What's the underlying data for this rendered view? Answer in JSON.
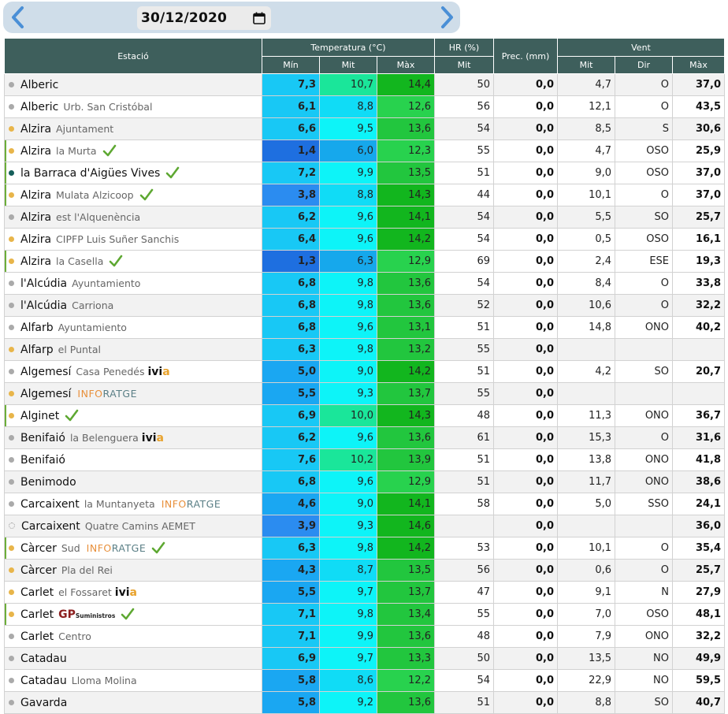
{
  "header": {
    "date": "30/12/2020"
  },
  "columns": {
    "station": "Estació",
    "temp": "Temperatura (°C)",
    "hr": "HR (%)",
    "prec": "Prec. (mm)",
    "wind": "Vent",
    "tmin": "Mín",
    "tmit": "Mit",
    "tmax": "Màx",
    "hrmit": "Mit",
    "wmit": "Mit",
    "wdir": "Dir",
    "wmax": "Màx"
  },
  "colors": {
    "header_bg": "#3e5f5c",
    "dot_orange": "#e8b54a",
    "dot_gray": "#aaaaaa",
    "dot_teal": "#155e5a",
    "check_green": "#5ea832"
  },
  "rows": [
    {
      "name": "Alberic",
      "sub": "",
      "dot": "gray",
      "check": false,
      "hl": false,
      "logo": "",
      "tmin": "7,3",
      "tmit": "10,7",
      "tmax": "14,4",
      "hr": "50",
      "prec": "0,0",
      "wmit": "4,7",
      "wdir": "O",
      "wmax": "37,0"
    },
    {
      "name": "Alberic",
      "sub": "Urb. San Cristóbal",
      "dot": "gray",
      "check": false,
      "hl": false,
      "logo": "",
      "tmin": "6,1",
      "tmit": "8,8",
      "tmax": "12,6",
      "hr": "56",
      "prec": "0,0",
      "wmit": "12,1",
      "wdir": "O",
      "wmax": "43,5"
    },
    {
      "name": "Alzira",
      "sub": "Ajuntament",
      "dot": "orange",
      "check": false,
      "hl": false,
      "logo": "",
      "tmin": "6,6",
      "tmit": "9,5",
      "tmax": "13,6",
      "hr": "54",
      "prec": "0,0",
      "wmit": "8,5",
      "wdir": "S",
      "wmax": "30,6"
    },
    {
      "name": "Alzira",
      "sub": "la Murta",
      "dot": "orange",
      "check": true,
      "hl": true,
      "logo": "",
      "tmin": "1,4",
      "tmit": "6,0",
      "tmax": "12,3",
      "hr": "55",
      "prec": "0,0",
      "wmit": "4,7",
      "wdir": "OSO",
      "wmax": "25,9"
    },
    {
      "name": "la Barraca d'Aigües Vives",
      "sub": "",
      "dot": "teal",
      "check": true,
      "hl": true,
      "logo": "",
      "tmin": "7,2",
      "tmit": "9,9",
      "tmax": "13,5",
      "hr": "51",
      "prec": "0,0",
      "wmit": "9,0",
      "wdir": "OSO",
      "wmax": "37,0"
    },
    {
      "name": "Alzira",
      "sub": "Mulata Alzicoop",
      "dot": "orange",
      "check": true,
      "hl": true,
      "logo": "",
      "tmin": "3,8",
      "tmit": "8,8",
      "tmax": "14,3",
      "hr": "44",
      "prec": "0,0",
      "wmit": "10,1",
      "wdir": "O",
      "wmax": "37,0"
    },
    {
      "name": "Alzira",
      "sub": "est l'Alquenència",
      "dot": "gray",
      "check": false,
      "hl": false,
      "logo": "",
      "tmin": "6,2",
      "tmit": "9,6",
      "tmax": "14,1",
      "hr": "54",
      "prec": "0,0",
      "wmit": "5,5",
      "wdir": "SO",
      "wmax": "25,7"
    },
    {
      "name": "Alzira",
      "sub": "CIPFP Luis Suñer Sanchis",
      "dot": "orange",
      "check": false,
      "hl": false,
      "logo": "",
      "tmin": "6,4",
      "tmit": "9,6",
      "tmax": "14,2",
      "hr": "54",
      "prec": "0,0",
      "wmit": "0,5",
      "wdir": "OSO",
      "wmax": "16,1"
    },
    {
      "name": "Alzira",
      "sub": "la Casella",
      "dot": "orange",
      "check": true,
      "hl": true,
      "logo": "",
      "tmin": "1,3",
      "tmit": "6,3",
      "tmax": "12,9",
      "hr": "69",
      "prec": "0,0",
      "wmit": "2,4",
      "wdir": "ESE",
      "wmax": "19,3"
    },
    {
      "name": "l'Alcúdia",
      "sub": "Ayuntamiento",
      "dot": "gray",
      "check": false,
      "hl": false,
      "logo": "",
      "tmin": "6,8",
      "tmit": "9,8",
      "tmax": "13,6",
      "hr": "54",
      "prec": "0,0",
      "wmit": "8,4",
      "wdir": "O",
      "wmax": "33,8"
    },
    {
      "name": "l'Alcúdia",
      "sub": "Carriona",
      "dot": "gray",
      "check": false,
      "hl": false,
      "logo": "",
      "tmin": "6,8",
      "tmit": "9,8",
      "tmax": "13,6",
      "hr": "52",
      "prec": "0,0",
      "wmit": "10,6",
      "wdir": "O",
      "wmax": "32,2"
    },
    {
      "name": "Alfarb",
      "sub": "Ayuntamiento",
      "dot": "gray",
      "check": false,
      "hl": false,
      "logo": "",
      "tmin": "6,8",
      "tmit": "9,6",
      "tmax": "13,1",
      "hr": "51",
      "prec": "0,0",
      "wmit": "14,8",
      "wdir": "ONO",
      "wmax": "40,2"
    },
    {
      "name": "Alfarp",
      "sub": "el Puntal",
      "dot": "orange",
      "check": false,
      "hl": false,
      "logo": "",
      "tmin": "6,3",
      "tmit": "9,8",
      "tmax": "13,2",
      "hr": "55",
      "prec": "0,0",
      "wmit": "",
      "wdir": "",
      "wmax": ""
    },
    {
      "name": "Algemesí",
      "sub": "Casa Penedés",
      "dot": "gray",
      "check": false,
      "hl": false,
      "logo": "ivia",
      "tmin": "5,0",
      "tmit": "9,0",
      "tmax": "14,2",
      "hr": "51",
      "prec": "0,0",
      "wmit": "4,2",
      "wdir": "SO",
      "wmax": "20,7"
    },
    {
      "name": "Algemesí",
      "sub": "",
      "dot": "orange",
      "check": false,
      "hl": false,
      "logo": "inforatge",
      "tmin": "5,5",
      "tmit": "9,3",
      "tmax": "13,7",
      "hr": "55",
      "prec": "0,0",
      "wmit": "",
      "wdir": "",
      "wmax": ""
    },
    {
      "name": "Alginet",
      "sub": "",
      "dot": "orange",
      "check": true,
      "hl": true,
      "logo": "",
      "tmin": "6,9",
      "tmit": "10,0",
      "tmax": "14,3",
      "hr": "48",
      "prec": "0,0",
      "wmit": "11,3",
      "wdir": "ONO",
      "wmax": "36,7"
    },
    {
      "name": "Benifaió",
      "sub": "la Belenguera",
      "dot": "gray",
      "check": false,
      "hl": false,
      "logo": "ivia",
      "tmin": "6,2",
      "tmit": "9,6",
      "tmax": "13,6",
      "hr": "61",
      "prec": "0,0",
      "wmit": "15,3",
      "wdir": "O",
      "wmax": "31,6"
    },
    {
      "name": "Benifaió",
      "sub": "",
      "dot": "gray",
      "check": false,
      "hl": false,
      "logo": "",
      "tmin": "7,6",
      "tmit": "10,2",
      "tmax": "13,9",
      "hr": "51",
      "prec": "0,0",
      "wmit": "13,8",
      "wdir": "ONO",
      "wmax": "41,8"
    },
    {
      "name": "Benimodo",
      "sub": "",
      "dot": "gray",
      "check": false,
      "hl": false,
      "logo": "",
      "tmin": "6,8",
      "tmit": "9,6",
      "tmax": "12,9",
      "hr": "51",
      "prec": "0,0",
      "wmit": "11,7",
      "wdir": "ONO",
      "wmax": "38,6"
    },
    {
      "name": "Carcaixent",
      "sub": "la Muntanyeta",
      "dot": "gray",
      "check": false,
      "hl": false,
      "logo": "inforatge",
      "tmin": "4,6",
      "tmit": "9,0",
      "tmax": "14,1",
      "hr": "58",
      "prec": "0,0",
      "wmit": "5,0",
      "wdir": "SSO",
      "wmax": "24,1"
    },
    {
      "name": "Carcaixent",
      "sub": "Quatre Camins AEMET",
      "dot": "dotted",
      "check": false,
      "hl": false,
      "logo": "",
      "tmin": "3,9",
      "tmit": "9,3",
      "tmax": "14,6",
      "hr": "",
      "prec": "0,0",
      "wmit": "",
      "wdir": "",
      "wmax": "36,0"
    },
    {
      "name": "Càrcer",
      "sub": "Sud",
      "dot": "orange",
      "check": true,
      "hl": true,
      "logo": "inforatge",
      "tmin": "6,3",
      "tmit": "9,8",
      "tmax": "14,2",
      "hr": "53",
      "prec": "0,0",
      "wmit": "10,1",
      "wdir": "O",
      "wmax": "35,4"
    },
    {
      "name": "Càrcer",
      "sub": "Pla del Rei",
      "dot": "orange",
      "check": false,
      "hl": false,
      "logo": "",
      "tmin": "4,3",
      "tmit": "8,7",
      "tmax": "13,5",
      "hr": "56",
      "prec": "0,0",
      "wmit": "0,6",
      "wdir": "O",
      "wmax": "25,7"
    },
    {
      "name": "Carlet",
      "sub": "el Fossaret",
      "dot": "orange",
      "check": false,
      "hl": false,
      "logo": "ivia",
      "tmin": "5,5",
      "tmit": "9,7",
      "tmax": "13,7",
      "hr": "47",
      "prec": "0,0",
      "wmit": "9,1",
      "wdir": "N",
      "wmax": "27,9"
    },
    {
      "name": "Carlet",
      "sub": "",
      "dot": "orange",
      "check": true,
      "hl": true,
      "logo": "gp",
      "tmin": "7,1",
      "tmit": "9,8",
      "tmax": "13,4",
      "hr": "55",
      "prec": "0,0",
      "wmit": "7,0",
      "wdir": "OSO",
      "wmax": "48,1"
    },
    {
      "name": "Carlet",
      "sub": "Centro",
      "dot": "gray",
      "check": false,
      "hl": false,
      "logo": "",
      "tmin": "7,1",
      "tmit": "9,9",
      "tmax": "13,6",
      "hr": "48",
      "prec": "0,0",
      "wmit": "7,9",
      "wdir": "ONO",
      "wmax": "32,2"
    },
    {
      "name": "Catadau",
      "sub": "",
      "dot": "gray",
      "check": false,
      "hl": false,
      "logo": "",
      "tmin": "6,9",
      "tmit": "9,7",
      "tmax": "13,3",
      "hr": "50",
      "prec": "0,0",
      "wmit": "13,5",
      "wdir": "NO",
      "wmax": "49,9"
    },
    {
      "name": "Catadau",
      "sub": "Lloma Molina",
      "dot": "gray",
      "check": false,
      "hl": false,
      "logo": "",
      "tmin": "5,8",
      "tmit": "8,6",
      "tmax": "12,2",
      "hr": "54",
      "prec": "0,0",
      "wmit": "22,9",
      "wdir": "NO",
      "wmax": "59,5"
    },
    {
      "name": "Gavarda",
      "sub": "",
      "dot": "gray",
      "check": false,
      "hl": false,
      "logo": "",
      "tmin": "5,8",
      "tmit": "9,2",
      "tmax": "13,6",
      "hr": "51",
      "prec": "0,0",
      "wmit": "8,8",
      "wdir": "SO",
      "wmax": "40,7"
    }
  ]
}
